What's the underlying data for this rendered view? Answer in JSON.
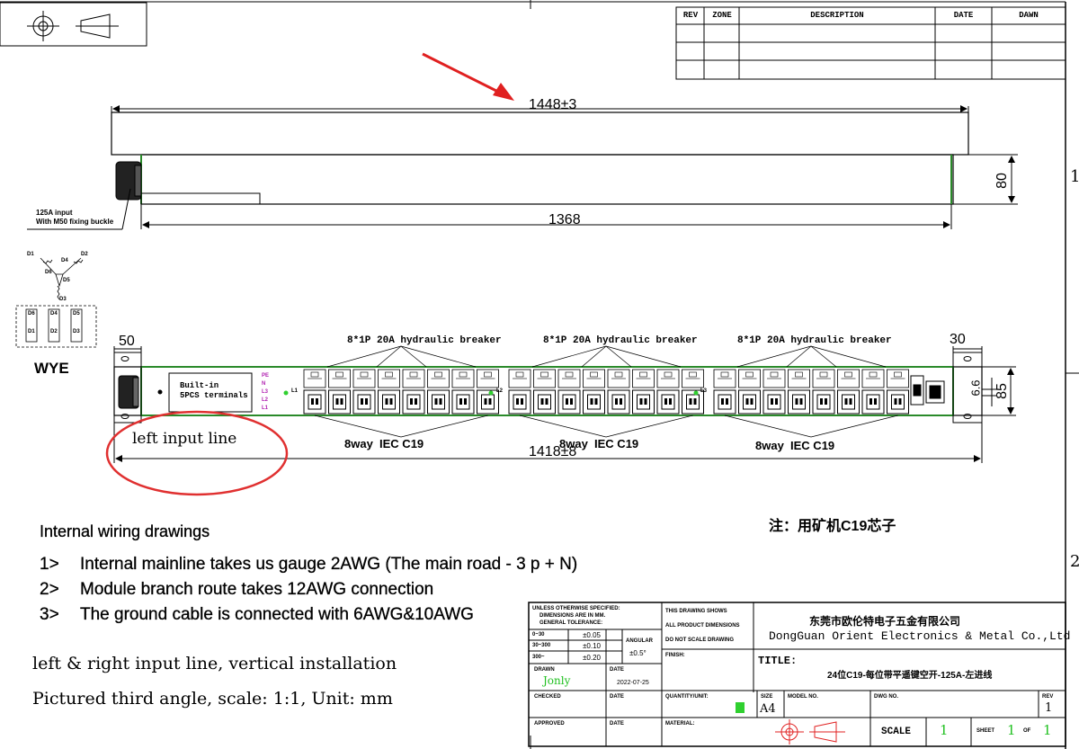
{
  "revision_table": {
    "headers": [
      "REV",
      "ZONE",
      "DESCRIPTION",
      "DATE",
      "DAWN"
    ]
  },
  "border_numbers": [
    "1",
    "2"
  ],
  "top_view": {
    "length_dim": "1448±3",
    "body_dim": "1368",
    "height_dim": "80",
    "input_note": [
      "125A input",
      "With M50 fixing buckle"
    ]
  },
  "wye": {
    "label": "WYE",
    "nodes": [
      "D1",
      "D2",
      "D3",
      "D4",
      "D5",
      "D6"
    ],
    "terminals": [
      "D6",
      "D4",
      "D5",
      "D1",
      "D2",
      "D3"
    ]
  },
  "front_view": {
    "dim_left": "50",
    "dim_right": "30",
    "dim_height": "85",
    "dim_width_small": "6.6",
    "overall_dim": "1418±8",
    "terminal_label": [
      "Built-in",
      "5PCS terminals"
    ],
    "phase_labels": [
      "PE",
      "N",
      "L3",
      "L2",
      "L1"
    ],
    "breaker_labels": [
      "8*1P 20A hydraulic breaker",
      "8*1P 20A hydraulic breaker",
      "8*1P 20A hydraulic breaker"
    ],
    "outlet_labels": [
      "8way  IEC C19",
      "8way  IEC C19",
      "8way  IEC C19"
    ],
    "group_markers": [
      "L1",
      "L2",
      "L3"
    ]
  },
  "annotation": "left input line",
  "chinese_note": "注：用矿机C19芯子",
  "notes": {
    "heading": "Internal wiring drawings",
    "items": [
      {
        "num": "1>",
        "text": "Internal mainline takes us gauge 2AWG (The main road - 3 p + N)"
      },
      {
        "num": "2>",
        "text": "Module branch route takes 12AWG connection"
      },
      {
        "num": "3>",
        "text": "The ground cable is connected with 6AWG&10AWG"
      }
    ],
    "install": "left & right input line, vertical installation",
    "projection": "Pictured third angle, scale: 1:1, Unit: mm"
  },
  "title_block": {
    "tolerance_head": [
      "UNLESS OTHERWISE SPECIFIED:",
      "DIMENSIONS ARE IN MM.",
      "GENERAL TOLERANCE:"
    ],
    "tolerances": [
      [
        "0~30",
        "±0.05"
      ],
      [
        "30~300",
        "±0.10"
      ],
      [
        "300~",
        "±0.20"
      ]
    ],
    "angular_label": "ANGULAR",
    "angular_value": "±0.5°",
    "drawing_shows": [
      "THIS DRAWING SHOWS",
      "ALL PRODUCT DIMENSIONS",
      "DO NOT SCALE DRAWING"
    ],
    "finish": "FINISH:",
    "company_cn": "东莞市欧伦特电子五金有限公司",
    "company_en": "DongGuan Orient Electronics & Metal Co.,Ltd",
    "drawn_label": "DRAWN",
    "drawn_by": "Jonly",
    "date_label": "DATE",
    "drawn_date": "2022-07-25",
    "title_label": "TITLE:",
    "title": "24位C19-每位带平遥键空开-125A-左进线",
    "checked_label": "CHECKED",
    "quantity_label": "QUANTITY/UNIT:",
    "size_label": "SIZE",
    "size": "A4",
    "model_label": "MODEL NO.",
    "dwg_label": "DWG NO.",
    "rev_label": "REV",
    "rev": "1",
    "approved_label": "APPROVED",
    "material_label": "MATERIAL:",
    "scale_label": "SCALE",
    "scale": "1",
    "sheet_label": "SHEET",
    "sheet": "1",
    "of_label": "OF",
    "sheets": "1"
  }
}
